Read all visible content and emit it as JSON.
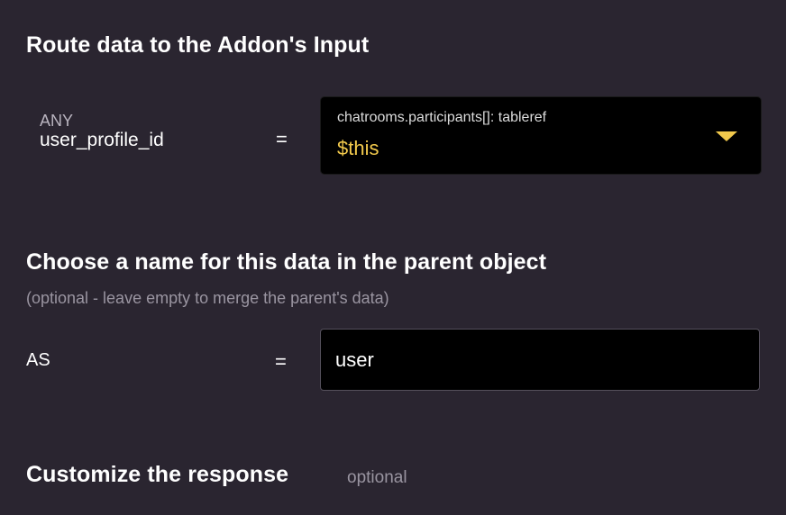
{
  "route_section": {
    "title": "Route data to the Addon's Input",
    "param": {
      "type": "ANY",
      "name": "user_profile_id",
      "operator": "="
    },
    "selector": {
      "path": "chatrooms.participants[]: tableref",
      "value": "$this",
      "icon": "caret-down-icon"
    }
  },
  "name_section": {
    "title": "Choose a name for this data in the parent object",
    "subtitle": "(optional - leave empty to merge the parent's data)",
    "as_label": "AS",
    "operator": "=",
    "input_value": "user"
  },
  "response_section": {
    "title": "Customize the response",
    "optional_label": "optional"
  },
  "colors": {
    "background": "#2a2530",
    "accent": "#f2c94c",
    "field_background": "#000000"
  }
}
